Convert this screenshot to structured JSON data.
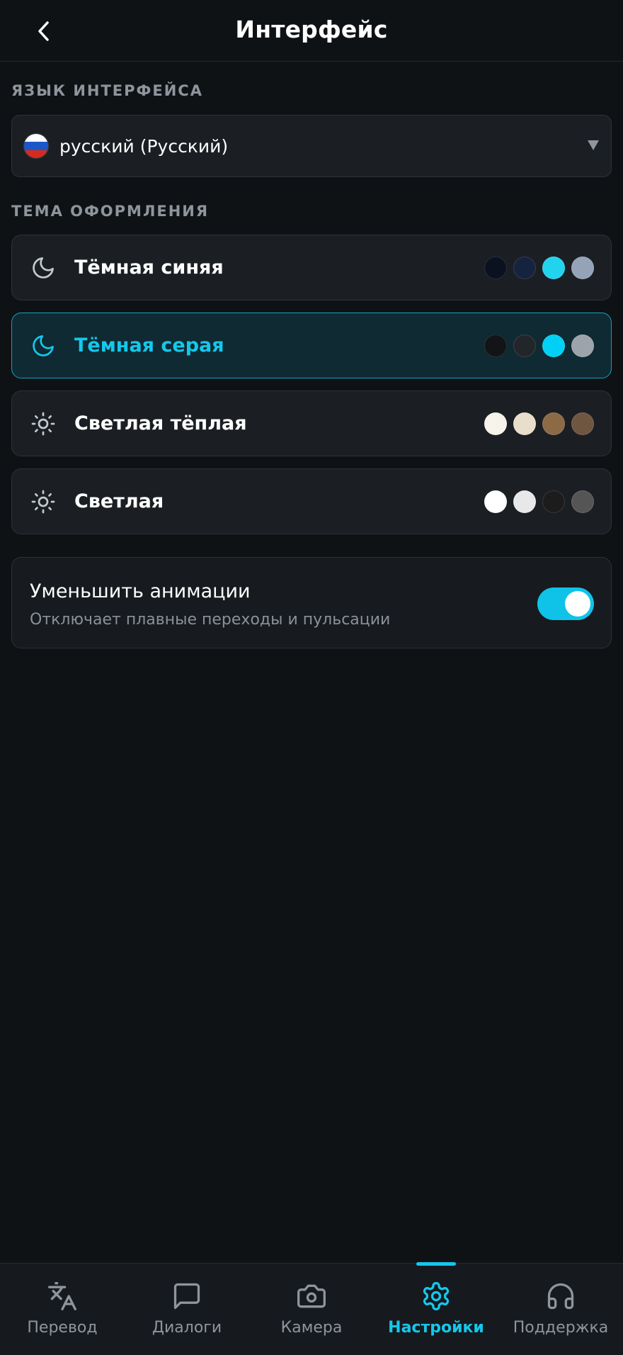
{
  "header": {
    "title": "Интерфейс"
  },
  "language": {
    "section_label": "ЯЗЫК ИНТЕРФЕЙСА",
    "selected": "русский (Русский)",
    "flag_colors": [
      "#ffffff",
      "#1c57c7",
      "#d52b1e"
    ]
  },
  "theme": {
    "section_label": "ТЕМА ОФОРМЛЕНИЯ",
    "items": [
      {
        "name": "Тёмная синяя",
        "icon": "moon-icon",
        "active": false,
        "swatches": [
          "#0b1120",
          "#16233f",
          "#22d3ee",
          "#94a3b8"
        ]
      },
      {
        "name": "Тёмная серая",
        "icon": "moon-icon",
        "active": true,
        "swatches": [
          "#121417",
          "#22262b",
          "#00d0f5",
          "#9ca3ab"
        ]
      },
      {
        "name": "Светлая тёплая",
        "icon": "sun-icon",
        "active": false,
        "swatches": [
          "#f7f2ea",
          "#e9ddcb",
          "#8c6a46",
          "#6e5640"
        ]
      },
      {
        "name": "Светлая",
        "icon": "sun-icon",
        "active": false,
        "swatches": [
          "#ffffff",
          "#e8e8e8",
          "#1c1c1c",
          "#555555"
        ]
      }
    ]
  },
  "animations": {
    "title": "Уменьшить анимации",
    "description": "Отключает плавные переходы и пульсации",
    "enabled": true
  },
  "nav": {
    "items": [
      {
        "label": "Перевод",
        "icon": "translate-icon",
        "active": false
      },
      {
        "label": "Диалоги",
        "icon": "chat-bubble-icon",
        "active": false
      },
      {
        "label": "Камера",
        "icon": "camera-icon",
        "active": false
      },
      {
        "label": "Настройки",
        "icon": "gear-icon",
        "active": true
      },
      {
        "label": "Поддержка",
        "icon": "headphones-icon",
        "active": false
      }
    ]
  },
  "colors": {
    "accent": "#14c8ec",
    "background": "#0f1215"
  }
}
